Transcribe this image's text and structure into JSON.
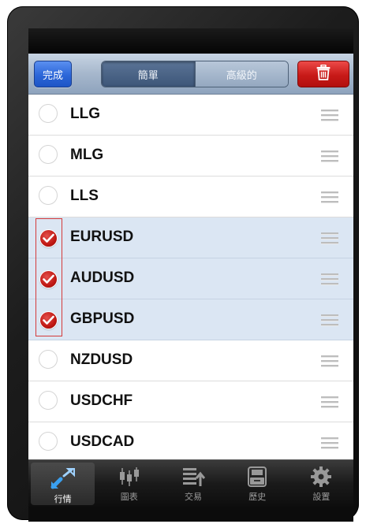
{
  "toolbar": {
    "done_label": "完成",
    "segments": {
      "simple": "簡單",
      "advanced": "高級的"
    },
    "delete_icon": "trash-icon"
  },
  "symbols": {
    "items": [
      {
        "label": "LLG",
        "selected": false
      },
      {
        "label": "MLG",
        "selected": false
      },
      {
        "label": "LLS",
        "selected": false
      },
      {
        "label": "EURUSD",
        "selected": true
      },
      {
        "label": "AUDUSD",
        "selected": true
      },
      {
        "label": "GBPUSD",
        "selected": true
      },
      {
        "label": "NZDUSD",
        "selected": false
      },
      {
        "label": "USDCHF",
        "selected": false
      },
      {
        "label": "USDCAD",
        "selected": false
      }
    ]
  },
  "tabbar": {
    "tabs": [
      {
        "label": "行情",
        "icon": "quotes-arrows-icon",
        "active": true
      },
      {
        "label": "圖表",
        "icon": "candlestick-chart-icon",
        "active": false
      },
      {
        "label": "交易",
        "icon": "trade-list-icon",
        "active": false
      },
      {
        "label": "歷史",
        "icon": "history-drawer-icon",
        "active": false
      },
      {
        "label": "設置",
        "icon": "gear-icon",
        "active": false
      }
    ]
  },
  "colors": {
    "accent_blue": "#2c66d8",
    "delete_red": "#c81a18",
    "selected_row": "#dbe6f3",
    "check_red": "#c01712"
  }
}
